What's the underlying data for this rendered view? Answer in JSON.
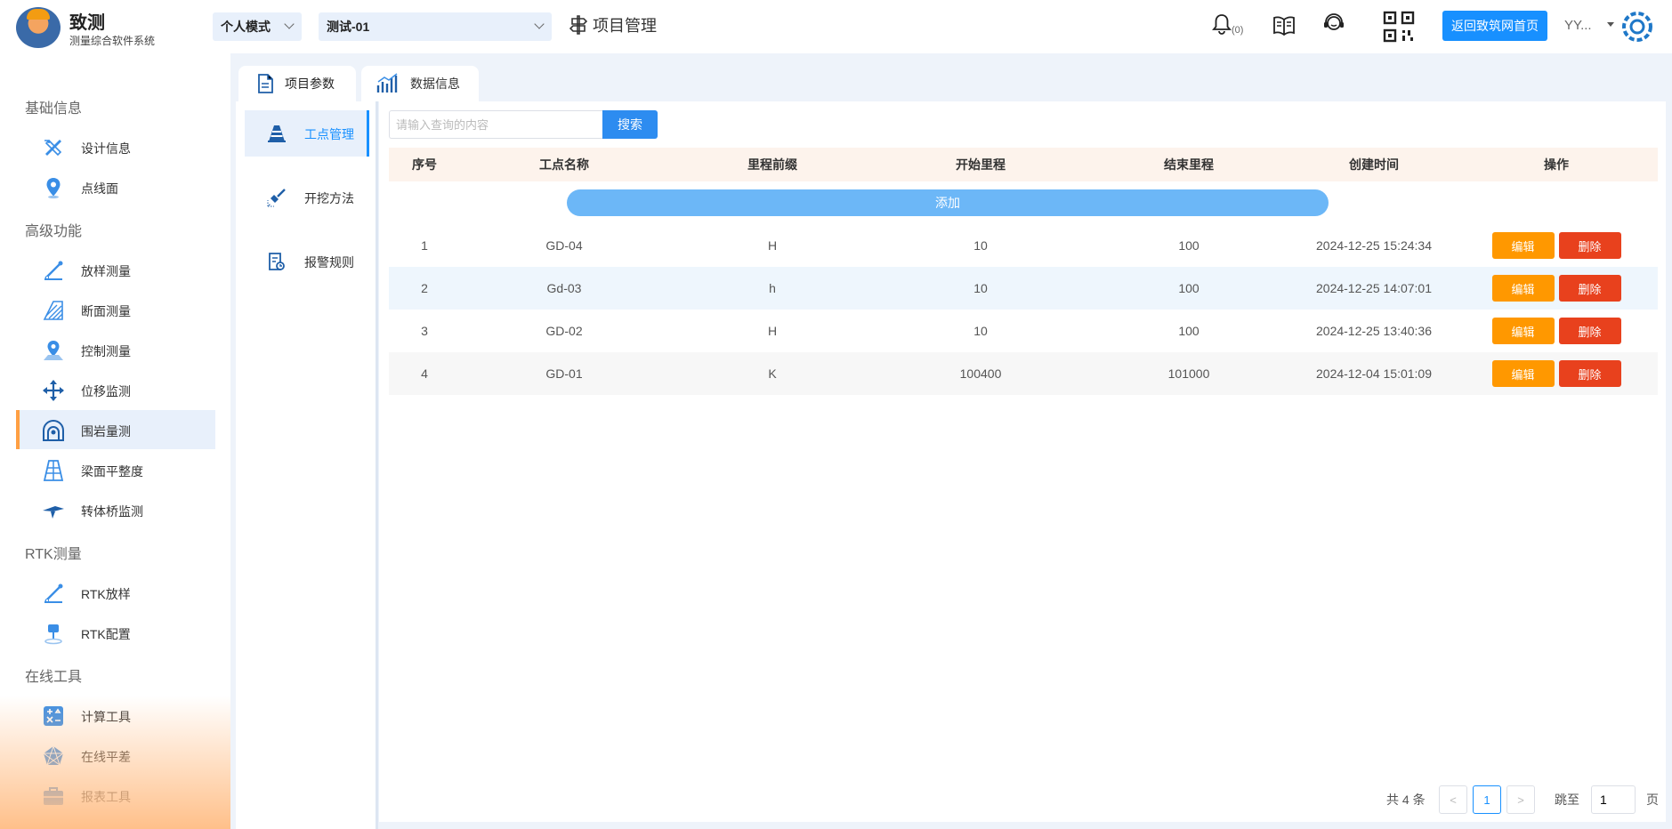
{
  "header": {
    "app_name": "致测",
    "app_subtitle": "测量综合软件系统",
    "mode_select": "个人模式",
    "project_select": "测试-01",
    "page_title": "项目管理",
    "bell_count": "(0)",
    "home_button": "返回致筑网首页",
    "user_name": "YY..."
  },
  "sidebar": {
    "sections": [
      {
        "title": "基础信息",
        "items": [
          {
            "label": "设计信息",
            "icon": "ruler-pencil-icon"
          },
          {
            "label": "点线面",
            "icon": "location-pin-icon"
          }
        ]
      },
      {
        "title": "高级功能",
        "items": [
          {
            "label": "放样测量",
            "icon": "stakeout-icon"
          },
          {
            "label": "断面测量",
            "icon": "section-icon"
          },
          {
            "label": "控制测量",
            "icon": "control-point-icon"
          },
          {
            "label": "位移监测",
            "icon": "move-arrows-icon"
          },
          {
            "label": "围岩量测",
            "icon": "tunnel-icon",
            "active": true
          },
          {
            "label": "梁面平整度",
            "icon": "beam-icon"
          },
          {
            "label": "转体桥监测",
            "icon": "bridge-icon"
          }
        ]
      },
      {
        "title": "RTK测量",
        "items": [
          {
            "label": "RTK放样",
            "icon": "rtk-stakeout-icon"
          },
          {
            "label": "RTK配置",
            "icon": "rtk-config-icon"
          }
        ]
      },
      {
        "title": "在线工具",
        "items": [
          {
            "label": "计算工具",
            "icon": "calculator-icon"
          },
          {
            "label": "在线平差",
            "icon": "network-icon"
          },
          {
            "label": "报表工具",
            "icon": "briefcase-icon"
          }
        ]
      }
    ]
  },
  "tabs": [
    {
      "label": "项目参数",
      "active": true
    },
    {
      "label": "数据信息",
      "active": false
    }
  ],
  "subnav": [
    {
      "label": "工点管理",
      "active": true
    },
    {
      "label": "开挖方法",
      "active": false
    },
    {
      "label": "报警规则",
      "active": false
    }
  ],
  "search": {
    "placeholder": "请输入查询的内容",
    "button": "搜索"
  },
  "table": {
    "columns": [
      "序号",
      "工点名称",
      "里程前缀",
      "开始里程",
      "结束里程",
      "创建时间",
      "操作"
    ],
    "add_label": "添加",
    "edit_label": "编辑",
    "delete_label": "删除",
    "rows": [
      {
        "no": "1",
        "name": "GD-04",
        "prefix": "H",
        "start": "10",
        "end": "100",
        "created": "2024-12-25 15:24:34"
      },
      {
        "no": "2",
        "name": "Gd-03",
        "prefix": "h",
        "start": "10",
        "end": "100",
        "created": "2024-12-25 14:07:01"
      },
      {
        "no": "3",
        "name": "GD-02",
        "prefix": "H",
        "start": "10",
        "end": "100",
        "created": "2024-12-25 13:40:36"
      },
      {
        "no": "4",
        "name": "GD-01",
        "prefix": "K",
        "start": "100400",
        "end": "101000",
        "created": "2024-12-04 15:01:09"
      }
    ]
  },
  "pagination": {
    "total": "共 4 条",
    "prev": "<",
    "current": "1",
    "next": ">",
    "jump_label": "跳至",
    "jump_value": "1",
    "unit": "页"
  },
  "colors": {
    "primary": "#1890ff",
    "edit": "#ff9800",
    "delete": "#e8411d",
    "accent": "#ff9f43"
  }
}
